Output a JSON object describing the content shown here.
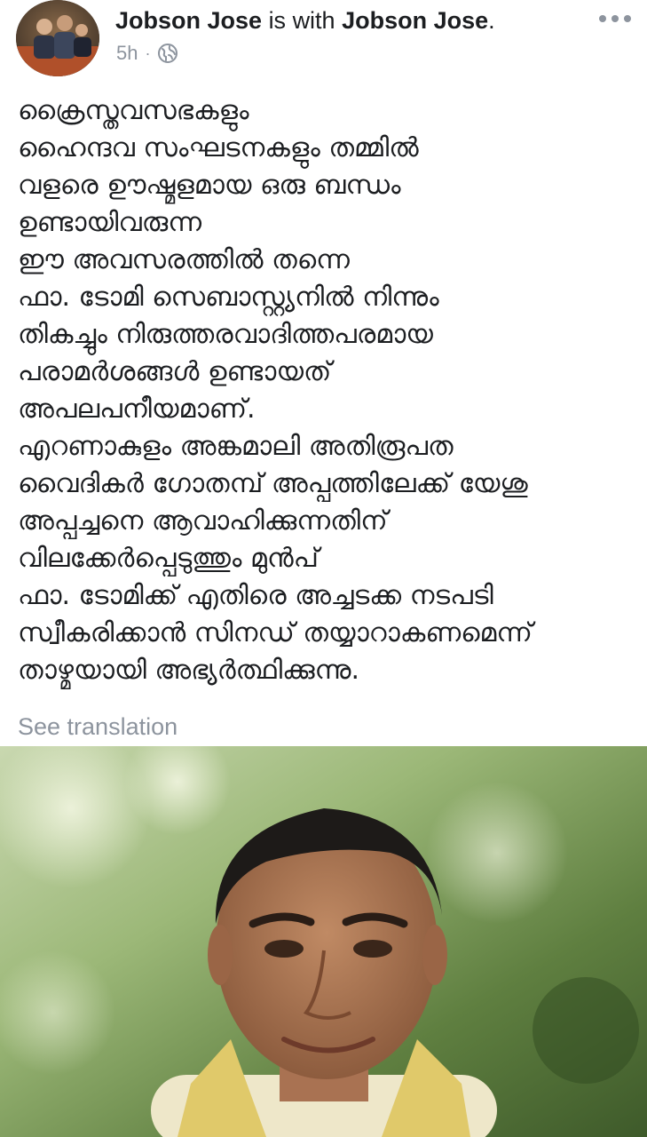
{
  "post": {
    "author": "Jobson Jose",
    "with_text": "is with",
    "tagged": "Jobson Jose",
    "tagged_suffix": ".",
    "time": "5h",
    "separator": "·",
    "privacy_icon": "globe-icon",
    "menu_icon": "more-horizontal-icon",
    "lines": [
      "ക്രൈസ്തവസഭകളും",
      "ഹൈന്ദവ സംഘടനകളും തമ്മിൽ",
      "വളരെ ഊഷ്മളമായ ഒരു ബന്ധം",
      "ഉണ്ടായിവരുന്ന",
      "ഈ അവസരത്തിൽ തന്നെ",
      "ഫാ. ടോമി സെബാസ്റ്റ്യനിൽ നിന്നും",
      "തികച്ചും നിരുത്തരവാദിത്തപരമായ",
      "പരാമർശങ്ങൾ ഉണ്ടായത്",
      "അപലപനീയമാണ്.",
      "എറണാകുളം അങ്കമാലി അതിരൂപത",
      "വൈദികർ ഗോതമ്പ് അപ്പത്തിലേക്ക് യേശു",
      "അപ്പച്ചനെ ആവാഹിക്കുന്നതിന്",
      "വിലക്കേർപ്പെടുത്തും മുൻപ്",
      "ഫാ. ടോമിക്ക് എതിരെ അച്ചടക്ക നടപടി",
      "സ്വീകരിക്കാൻ സിനഡ് തയ്യാറാകണമെന്ന്",
      "താഴ്മയായി അഭ്യർത്ഥിക്കുന്നു."
    ],
    "see_translation": "See translation"
  }
}
